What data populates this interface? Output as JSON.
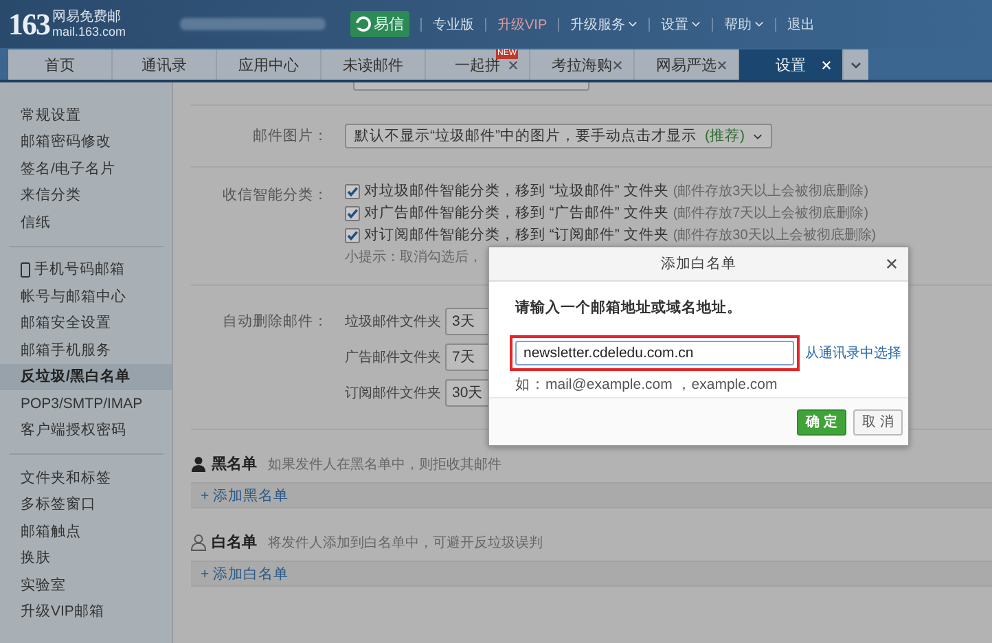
{
  "header": {
    "logo": "163",
    "brand": "网易免费邮",
    "domain": "mail.163.com",
    "nav": [
      {
        "label": "易信",
        "kind": "badge"
      },
      {
        "label": "专业版",
        "kind": "link"
      },
      {
        "label": "升级VIP",
        "kind": "vip"
      },
      {
        "label": "升级服务",
        "kind": "menu"
      },
      {
        "label": "设置",
        "kind": "menu"
      },
      {
        "label": "帮助",
        "kind": "menu"
      },
      {
        "label": "退出",
        "kind": "link"
      }
    ]
  },
  "tabs": [
    {
      "label": "首页",
      "selected": false,
      "closable": false
    },
    {
      "label": "通讯录",
      "selected": false,
      "closable": false
    },
    {
      "label": "应用中心",
      "selected": false,
      "closable": false
    },
    {
      "label": "未读邮件",
      "selected": false,
      "closable": false
    },
    {
      "label": "一起拼",
      "selected": false,
      "closable": true,
      "badge": "NEW"
    },
    {
      "label": "考拉海购",
      "selected": false,
      "closable": true
    },
    {
      "label": "网易严选",
      "selected": false,
      "closable": true
    },
    {
      "label": "设置",
      "selected": true,
      "closable": true
    }
  ],
  "sidebar": {
    "groups": [
      {
        "items": [
          {
            "label": "常规设置",
            "selected": false,
            "kind": "plain"
          },
          {
            "label": "邮箱密码修改",
            "selected": false,
            "kind": "plain"
          },
          {
            "label": "签名/电子名片",
            "selected": false,
            "kind": "plain"
          },
          {
            "label": "来信分类",
            "selected": false,
            "kind": "plain"
          },
          {
            "label": "信纸",
            "selected": false,
            "kind": "plain"
          }
        ]
      },
      {
        "items": [
          {
            "label": "手机号码邮箱",
            "selected": false,
            "kind": "phone"
          },
          {
            "label": "帐号与邮箱中心",
            "selected": false,
            "kind": "plain"
          },
          {
            "label": "邮箱安全设置",
            "selected": false,
            "kind": "plain"
          },
          {
            "label": "邮箱手机服务",
            "selected": false,
            "kind": "plain"
          },
          {
            "label": "反垃圾/黑白名单",
            "selected": true,
            "kind": "plain"
          },
          {
            "label": "POP3/SMTP/IMAP",
            "selected": false,
            "kind": "plain"
          },
          {
            "label": "客户端授权密码",
            "selected": false,
            "kind": "plain"
          }
        ]
      },
      {
        "items": [
          {
            "label": "文件夹和标签",
            "selected": false,
            "kind": "plain"
          },
          {
            "label": "多标签窗口",
            "selected": false,
            "kind": "plain"
          },
          {
            "label": "邮箱触点",
            "selected": false,
            "kind": "plain"
          },
          {
            "label": "换肤",
            "selected": false,
            "kind": "plain"
          },
          {
            "label": "实验室",
            "selected": false,
            "kind": "plain"
          },
          {
            "label": "升级VIP邮箱",
            "selected": false,
            "kind": "plain"
          }
        ]
      }
    ]
  },
  "settings": {
    "image_row": {
      "label": "邮件图片：",
      "value": "默认不显示“垃圾邮件”中的图片，要手动点击才显示",
      "note": "(推荐)"
    },
    "classify": {
      "label": "收信智能分类：",
      "options": [
        {
          "label": "对垃圾邮件智能分类，移到 “垃圾邮件” 文件夹",
          "note": "(邮件存放3天以上会被彻底删除)",
          "checked": true
        },
        {
          "label": "对广告邮件智能分类，移到 “广告邮件” 文件夹",
          "note": "(邮件存放7天以上会被彻底删除)",
          "checked": true
        },
        {
          "label": "对订阅邮件智能分类，移到 “订阅邮件” 文件夹",
          "note": "(邮件存放30天以上会被彻底删除)",
          "checked": true
        }
      ],
      "hint": "小提示：取消勾选后，"
    },
    "auto_delete": {
      "label": "自动删除邮件：",
      "rows": [
        {
          "folder": "垃圾邮件文件夹",
          "value": "3天"
        },
        {
          "folder": "广告邮件文件夹",
          "value": "7天"
        },
        {
          "folder": "订阅邮件文件夹",
          "value": "30天"
        }
      ]
    }
  },
  "lists": [
    {
      "kind": "block",
      "title": "黑名单",
      "description": "如果发件人在黑名单中，则拒收其邮件",
      "add": "+ 添加黑名单"
    },
    {
      "kind": "allow",
      "title": "白名单",
      "description": "将发件人添加到白名单中，可避开反垃圾误判",
      "add": "+ 添加白名单"
    }
  ],
  "dialog": {
    "title": "添加白名单",
    "message": "请输入一个邮箱地址或域名地址。",
    "value": "newsletter.cdeledu.com.cn",
    "link": "从通讯录中选择",
    "example": "如：mail@example.com ，example.com",
    "buttons": [
      {
        "label": "确 定",
        "kind": "primary"
      },
      {
        "label": "取 消",
        "kind": "secondary"
      }
    ]
  }
}
